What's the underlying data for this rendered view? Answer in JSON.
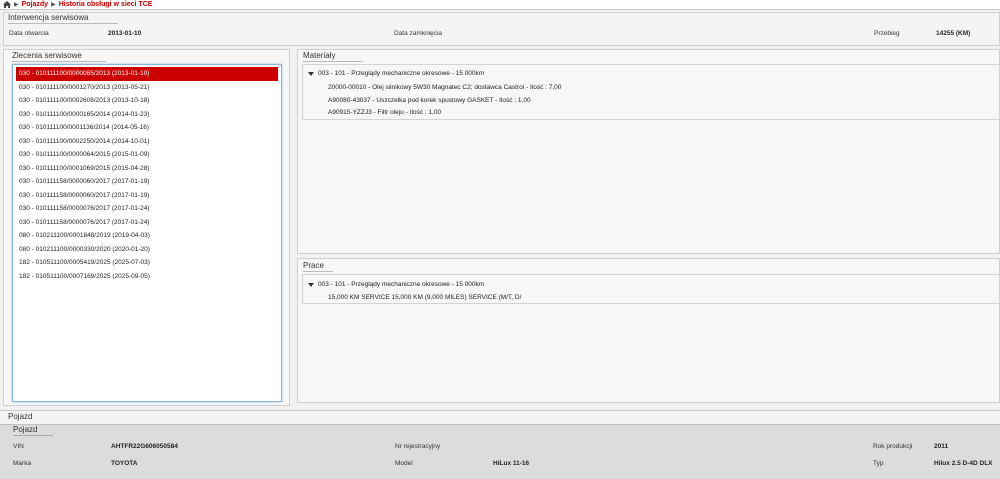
{
  "breadcrumb": {
    "items": [
      "Pojazdy",
      "Historia obsługi w sieci TCE"
    ]
  },
  "intervention": {
    "title": "Interwencja serwisowa",
    "open_label": "Data otwarcia",
    "open_value": "2013-01-10",
    "close_label": "Data zamknięcia",
    "close_value": "",
    "mileage_label": "Przebieg",
    "mileage_value": "14255 (KM)"
  },
  "orders": {
    "title": "Zlecenia serwisowe",
    "items": [
      "030 - 010111100/0000085/2013 (2013-01-10)",
      "030 - 010111100/0001270/2013 (2013-05-21)",
      "030 - 010111100/0002608/2013 (2013-10-18)",
      "030 - 010111100/0000165/2014 (2014-01-23)",
      "030 - 010111100/0001136/2014 (2014-05-16)",
      "030 - 010111100/0002250/2014 (2014-10-01)",
      "030 - 010111100/0000064/2015 (2015-01-09)",
      "030 - 010111100/0001069/2015 (2015-04-28)",
      "030 - 010111158/0000060/2017 (2017-01-19)",
      "030 - 010111158/0000060/2017 (2017-01-19)",
      "030 - 010111158/0000076/2017 (2017-01-24)",
      "030 - 010111158/0000076/2017 (2017-01-24)",
      "080 - 010211100/0001848/2019 (2019-04-03)",
      "080 - 010211100/0000330/2020 (2020-01-20)",
      "182 - 010511100/0005419/2025 (2025-07-03)",
      "182 - 010511100/0007169/2025 (2025-09-05)"
    ]
  },
  "materials": {
    "title": "Materiały",
    "group": "003 - 101 - Przeglądy mechaniczne okresowe - 15 000km",
    "items": [
      "20000-00010 - Olej silnikowy 5W30 Magnatec C2; dostawca Castrol - Ilość : 7,00",
      "A90080-43037 - Uszczelka pod korek spustowy GASKET - Ilość : 1,00",
      "A90915-YZZJ3 - Filtr oleju - Ilość : 1,00"
    ]
  },
  "works": {
    "title": "Prace",
    "group": "003 - 101 - Przeglądy mechaniczne okresowe - 15 000km",
    "items": [
      "15,000 KM SERVICE 15,000 KM (9,000 MILES) SERVICE (M/T, D/"
    ]
  },
  "vehicle": {
    "outer_title": "Pojazd",
    "title": "Pojazd",
    "vin_label": "VIN",
    "vin_value": "AHTFR22G606050584",
    "make_label": "Marka",
    "make_value": "TOYOTA",
    "reg_label": "Nr rejestracyjny",
    "reg_value": "",
    "model_label": "Model",
    "model_value": "HiLux 11-16",
    "year_label": "Rok produkcji",
    "year_value": "2011",
    "type_label": "Typ",
    "type_value": "Hilux 2.5 D-4D DLX"
  },
  "colors": {
    "accent": "#cc0000",
    "link": "#c00000",
    "list_border": "#8eb3d6"
  }
}
